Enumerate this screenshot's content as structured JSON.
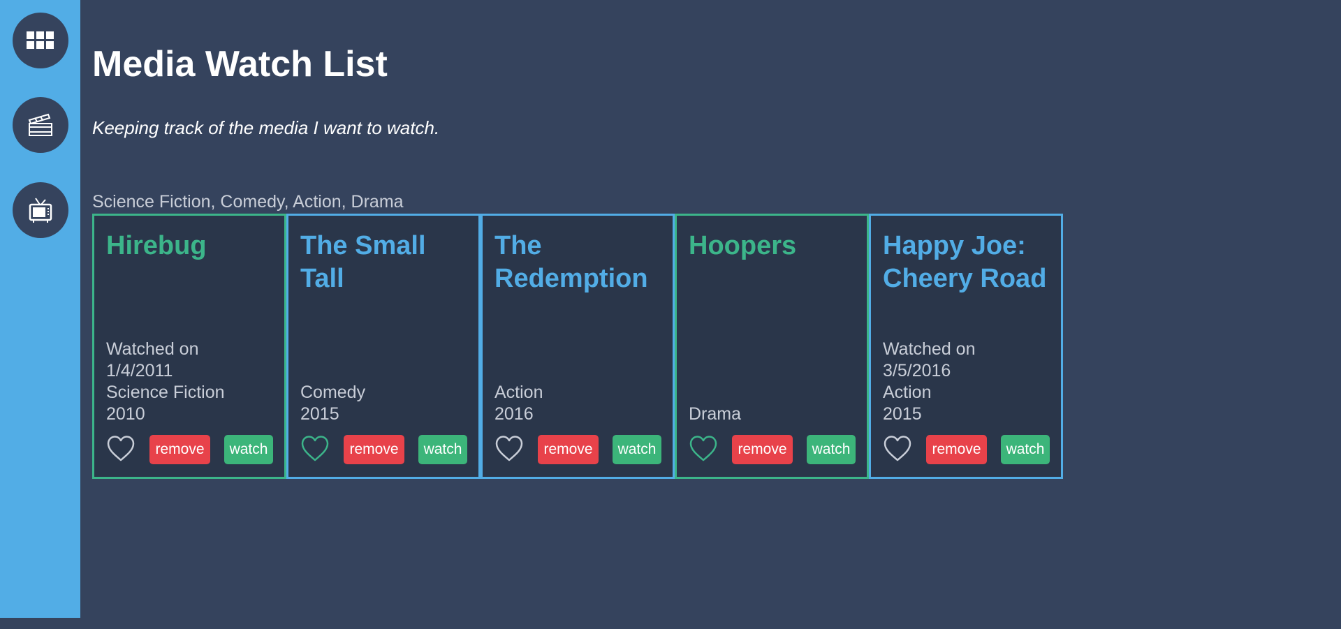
{
  "sidebar": {
    "items": [
      {
        "name": "grid",
        "icon": "grid-icon"
      },
      {
        "name": "movies",
        "icon": "clapperboard-icon"
      },
      {
        "name": "tv",
        "icon": "tv-icon"
      }
    ]
  },
  "header": {
    "title": "Media Watch List",
    "subtitle": "Keeping track of the media I want to watch."
  },
  "genres_text": "Science Fiction, Comedy, Action, Drama",
  "colors": {
    "background": "#35435d",
    "sidebar": "#52ade6",
    "unwatched_accent": "#52ade6",
    "watched_accent": "#3cb58a",
    "remove": "#e8424a",
    "watch": "#3cb57a"
  },
  "cards": [
    {
      "title": "Hirebug",
      "watched": true,
      "favorited": false,
      "watched_label": "Watched on",
      "watched_date": "1/4/2011",
      "genre": "Science Fiction",
      "year": "2010",
      "remove_label": "remove",
      "watch_label": "watch"
    },
    {
      "title": "The Small Tall",
      "watched": false,
      "favorited": true,
      "watched_label": "",
      "watched_date": "",
      "genre": "Comedy",
      "year": "2015",
      "remove_label": "remove",
      "watch_label": "watch"
    },
    {
      "title": "The Redemption",
      "watched": false,
      "favorited": false,
      "watched_label": "",
      "watched_date": "",
      "genre": "Action",
      "year": "2016",
      "remove_label": "remove",
      "watch_label": "watch"
    },
    {
      "title": "Hoopers",
      "watched": true,
      "favorited": true,
      "watched_label": "",
      "watched_date": "",
      "genre": "",
      "year": "Drama",
      "remove_label": "remove",
      "watch_label": "watch"
    },
    {
      "title": "Happy Joe: Cheery Road",
      "watched": false,
      "favorited": false,
      "watched_label": "Watched on",
      "watched_date": "3/5/2016",
      "genre": "Action",
      "year": "2015",
      "remove_label": "remove",
      "watch_label": "watch"
    }
  ]
}
